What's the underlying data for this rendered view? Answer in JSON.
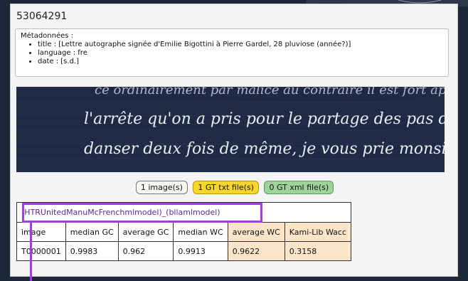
{
  "document": {
    "id": "53064291",
    "metadata": {
      "heading": "Métadonnées :",
      "items": [
        "title : [Lettre autographe signée d'Emilie Bigottini à Pierre Gardel, 28 pluviose (année?)]",
        "language : fre",
        "date : [s.d.]"
      ]
    },
    "handwriting": {
      "line1": "l'arrête qu'on a pris pour le partage des pas de le",
      "line2": "danser deux fois de même, je vous prie monsieur"
    }
  },
  "badges": {
    "images": "1 image(s)",
    "gt_txt": "1 GT txt file(s)",
    "gt_xml": "0 GT xml file(s)"
  },
  "table": {
    "model": "(HTRUnitedManuMcFrenchmlmodel)_(bllamlmodel)",
    "headers": [
      "image",
      "median GC",
      "average GC",
      "median WC",
      "average WC",
      "Kami-Lib Wacc"
    ],
    "rows": [
      [
        "T0000001",
        "0.9983",
        "0.962",
        "0.9913",
        "0.9622",
        "0.3158"
      ]
    ]
  },
  "colors": {
    "highlight": "#a23be0",
    "gt_txt_badge": "#f8d72a",
    "gt_xml_badge": "#9ed39a",
    "wc_columns": "#fbe5c8"
  }
}
